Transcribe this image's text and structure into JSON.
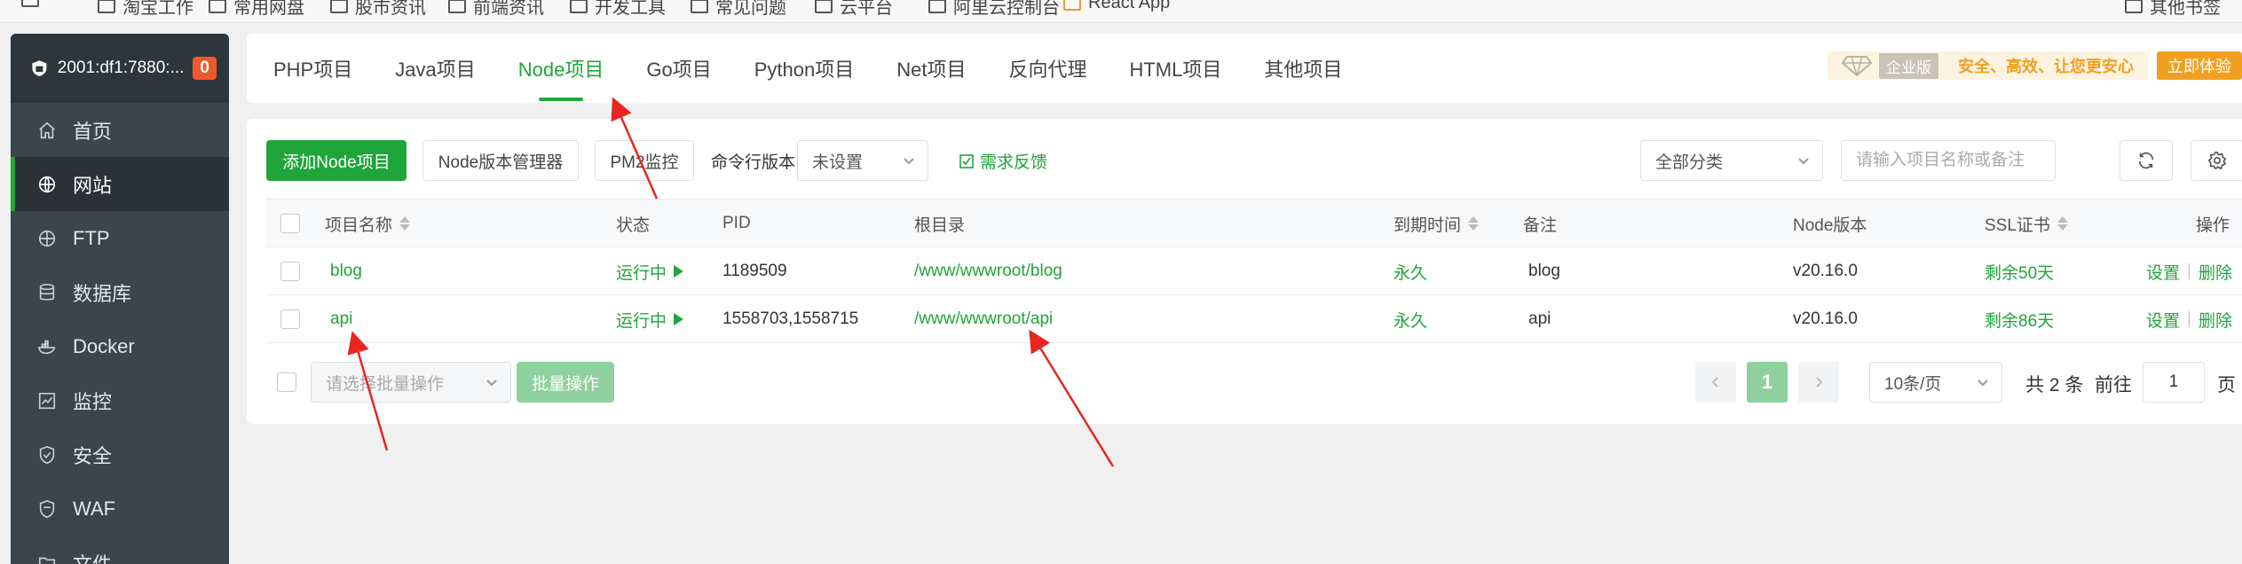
{
  "bookmarks": [
    "淘宝工作",
    "常用网盘",
    "股市资讯",
    "前端资讯",
    "开发工具",
    "常见问题",
    "云平台",
    "阿里云控制台",
    "React App",
    "其他书签"
  ],
  "sidebar": {
    "server": "2001:df1:7880:...",
    "badge": "0",
    "items": [
      {
        "label": "首页",
        "icon": "home-icon"
      },
      {
        "label": "网站",
        "icon": "globe-icon"
      },
      {
        "label": "FTP",
        "icon": "ftp-globe-icon"
      },
      {
        "label": "数据库",
        "icon": "database-icon"
      },
      {
        "label": "Docker",
        "icon": "docker-whale-icon"
      },
      {
        "label": "监控",
        "icon": "chart-icon"
      },
      {
        "label": "安全",
        "icon": "shield-icon"
      },
      {
        "label": "WAF",
        "icon": "waf-shield-icon"
      },
      {
        "label": "文件",
        "icon": "folder-icon"
      }
    ]
  },
  "tabs": [
    "PHP项目",
    "Java项目",
    "Node项目",
    "Go项目",
    "Python项目",
    "Net项目",
    "反向代理",
    "HTML项目",
    "其他项目"
  ],
  "active_tab": "Node项目",
  "promo": {
    "tag": "企业版",
    "text": "安全、高效、让您更安心",
    "button": "立即体验"
  },
  "toolbar": {
    "add_button": "添加Node项目",
    "version_manager": "Node版本管理器",
    "pm2": "PM2监控",
    "cli_label": "命令行版本",
    "cli_value": "未设置",
    "feedback": "需求反馈",
    "category": "全部分类",
    "search_placeholder": "请输入项目名称或备注"
  },
  "table": {
    "headers": [
      "项目名称",
      "状态",
      "PID",
      "根目录",
      "到期时间",
      "备注",
      "Node版本",
      "SSL证书",
      "操作"
    ],
    "rows": [
      {
        "name": "blog",
        "status": "运行中",
        "pid": "1189509",
        "root": "/www/wwwroot/blog",
        "expire": "永久",
        "remark": "blog",
        "node": "v20.16.0",
        "ssl": "剩余50天",
        "action1": "设置",
        "action2": "删除"
      },
      {
        "name": "api",
        "status": "运行中",
        "pid": "1558703,1558715",
        "root": "/www/wwwroot/api",
        "expire": "永久",
        "remark": "api",
        "node": "v20.16.0",
        "ssl": "剩余86天",
        "action1": "设置",
        "action2": "删除"
      }
    ]
  },
  "footer": {
    "batch_placeholder": "请选择批量操作",
    "batch_button": "批量操作",
    "current_page": "1",
    "per_page": "10条/页",
    "total": "共 2 条",
    "goto_label": "前往",
    "goto_value": "1",
    "page_suffix": "页"
  },
  "colors": {
    "accent": "#20a53a",
    "sidebar": "#3c444d",
    "promo": "#f0a020",
    "arrow": "#e8261f"
  }
}
